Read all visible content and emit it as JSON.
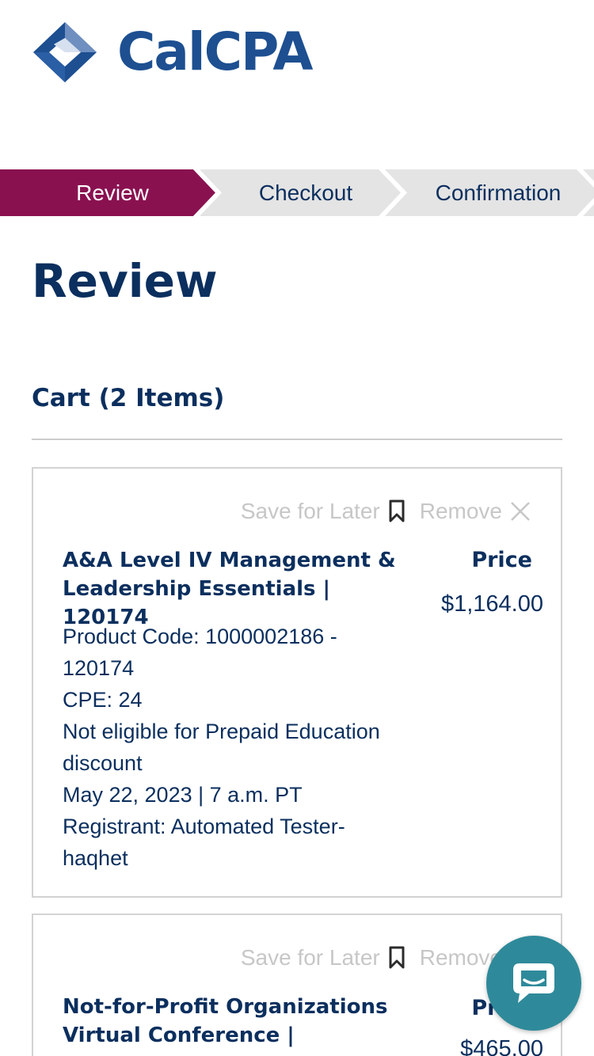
{
  "brand": {
    "name": "CalCPA",
    "color": "#1d4f91"
  },
  "stepper": {
    "steps": [
      {
        "label": "Review",
        "state": "active"
      },
      {
        "label": "Checkout",
        "state": "inactive"
      },
      {
        "label": "Confirmation",
        "state": "inactive"
      }
    ],
    "active_color": "#8a1150",
    "inactive_color": "#e4e4e4"
  },
  "page_title": "Review",
  "cart": {
    "heading": "Cart (2 Items)",
    "save_for_later_label": "Save for Later",
    "remove_label": "Remove",
    "price_header": "Price",
    "items": [
      {
        "title": "A&A Level IV Management & Leadership Essentials | 120174",
        "price": "$1,164.00",
        "details": [
          "Product Code: 1000002186 - 120174",
          "CPE: 24",
          "Not eligible for Prepaid Education discount",
          "May 22, 2023 | 7 a.m. PT",
          "Registrant: Automated Tester-haqhet"
        ]
      },
      {
        "title": "Not-for-Profit Organizations Virtual Conference |",
        "price": "$465.00",
        "details": []
      }
    ]
  },
  "chat": {
    "icon": "chat-bubble-icon",
    "color": "#2e8a9a"
  }
}
